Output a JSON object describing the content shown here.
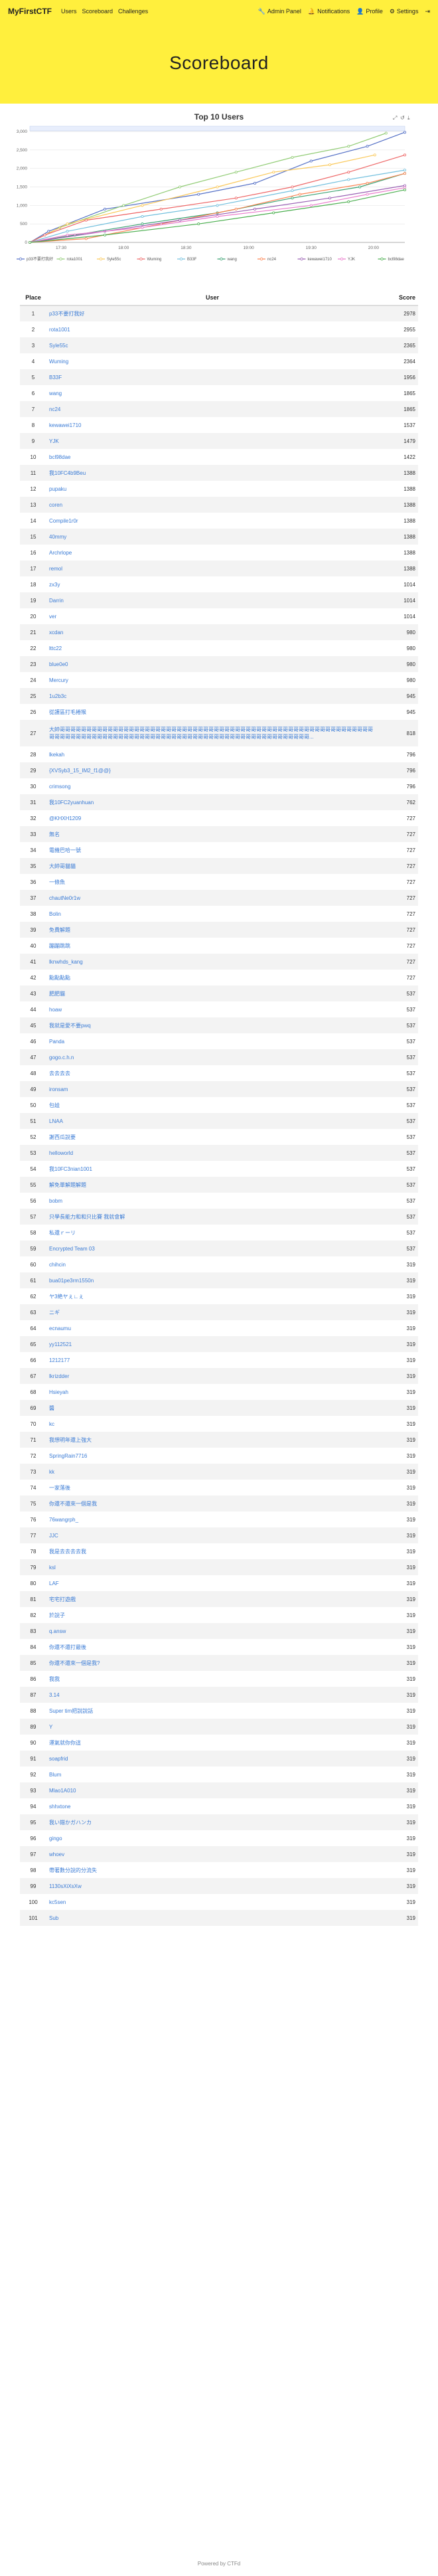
{
  "nav": {
    "brand": "MyFirstCTF",
    "left": [
      "Users",
      "Scoreboard",
      "Challenges"
    ],
    "right": [
      {
        "icon": "wrench-icon",
        "glyph": "🔧",
        "label": "Admin Panel"
      },
      {
        "icon": "bell-icon",
        "glyph": "🔔",
        "label": "Notifications"
      },
      {
        "icon": "user-circle-icon",
        "glyph": "👤",
        "label": "Profile"
      },
      {
        "icon": "gear-icon",
        "glyph": "⚙",
        "label": "Settings"
      },
      {
        "icon": "logout-icon",
        "glyph": "⇥",
        "label": ""
      }
    ]
  },
  "page_title": "Scoreboard",
  "table": {
    "headers": {
      "place": "Place",
      "user": "User",
      "score": "Score"
    }
  },
  "rows": [
    {
      "place": "1",
      "user": "p33不要打我好",
      "score": "2978"
    },
    {
      "place": "2",
      "user": "rota1001",
      "score": "2955"
    },
    {
      "place": "3",
      "user": "Syle55c",
      "score": "2365"
    },
    {
      "place": "4",
      "user": "Wuming",
      "score": "2364"
    },
    {
      "place": "5",
      "user": "B33F",
      "score": "1956"
    },
    {
      "place": "6",
      "user": "wang",
      "score": "1865"
    },
    {
      "place": "7",
      "user": "nc24",
      "score": "1865"
    },
    {
      "place": "8",
      "user": "kewawei1710",
      "score": "1537"
    },
    {
      "place": "9",
      "user": "YJK",
      "score": "1479"
    },
    {
      "place": "10",
      "user": "bcl98dae",
      "score": "1422"
    },
    {
      "place": "11",
      "user": "我10FC4b9Beu",
      "score": "1388"
    },
    {
      "place": "12",
      "user": "pupaku",
      "score": "1388"
    },
    {
      "place": "13",
      "user": "coren",
      "score": "1388"
    },
    {
      "place": "14",
      "user": "Compile1r0r",
      "score": "1388"
    },
    {
      "place": "15",
      "user": "40mmy",
      "score": "1388"
    },
    {
      "place": "16",
      "user": "Archrlope",
      "score": "1388"
    },
    {
      "place": "17",
      "user": "remol",
      "score": "1388"
    },
    {
      "place": "18",
      "user": "zx3y",
      "score": "1014"
    },
    {
      "place": "19",
      "user": "Darrin",
      "score": "1014"
    },
    {
      "place": "20",
      "user": "ver",
      "score": "1014"
    },
    {
      "place": "21",
      "user": "xcdan",
      "score": "980"
    },
    {
      "place": "22",
      "user": "lttc22",
      "score": "980"
    },
    {
      "place": "23",
      "user": "blue0e0",
      "score": "980"
    },
    {
      "place": "24",
      "user": "Mercury",
      "score": "980"
    },
    {
      "place": "25",
      "user": "1u2b3c",
      "score": "945"
    },
    {
      "place": "26",
      "user": "從護區打毛捲猴",
      "score": "945"
    },
    {
      "place": "27",
      "user": "大帥哥哥哥哥哥哥哥哥哥哥哥哥哥哥哥哥哥哥哥哥哥哥哥哥哥哥哥哥哥哥哥哥哥哥哥哥哥哥哥哥哥哥哥哥哥哥哥哥哥哥哥哥哥哥哥哥哥哥哥哥哥哥哥哥哥哥哥哥哥哥哥哥哥哥哥哥哥哥哥哥哥哥哥哥哥哥哥哥哥哥哥哥哥哥哥哥哥哥哥哥哥哥哥哥哥哥哥哥...",
      "score": "818",
      "tall": true
    },
    {
      "place": "28",
      "user": "lkekah",
      "score": "796"
    },
    {
      "place": "29",
      "user": "{XVSyb3_15_IM2_f1@@}",
      "score": "796"
    },
    {
      "place": "30",
      "user": "crimsong",
      "score": "796"
    },
    {
      "place": "31",
      "user": "我10FC2yuanhuan",
      "score": "762"
    },
    {
      "place": "32",
      "user": "@KHXH1209",
      "score": "727"
    },
    {
      "place": "33",
      "user": "無名",
      "score": "727"
    },
    {
      "place": "34",
      "user": "電機巴哈一號",
      "score": "727"
    },
    {
      "place": "35",
      "user": "大帥哥貓貓",
      "score": "727"
    },
    {
      "place": "36",
      "user": "一條魚",
      "score": "727"
    },
    {
      "place": "37",
      "user": "chautNe0r1w",
      "score": "727"
    },
    {
      "place": "38",
      "user": "Bolin",
      "score": "727"
    },
    {
      "place": "39",
      "user": "免費解題",
      "score": "727"
    },
    {
      "place": "40",
      "user": "蹦蹦跳跳",
      "score": "727"
    },
    {
      "place": "41",
      "user": "lknwhds_kang",
      "score": "727"
    },
    {
      "place": "42",
      "user": "點點點點",
      "score": "727"
    },
    {
      "place": "43",
      "user": "肥肥貓",
      "score": "537"
    },
    {
      "place": "44",
      "user": "hoaw",
      "score": "537"
    },
    {
      "place": "45",
      "user": "我就是愛不要pwq",
      "score": "537"
    },
    {
      "place": "46",
      "user": "Panda",
      "score": "537"
    },
    {
      "place": "47",
      "user": "gogo.c.h.n",
      "score": "537"
    },
    {
      "place": "48",
      "user": "去去去去",
      "score": "537"
    },
    {
      "place": "49",
      "user": "ironsam",
      "score": "537"
    },
    {
      "place": "50",
      "user": "包娃",
      "score": "537"
    },
    {
      "place": "51",
      "user": "LNAA",
      "score": "537"
    },
    {
      "place": "52",
      "user": "謝西瓜說要",
      "score": "537"
    },
    {
      "place": "53",
      "user": "helloworld",
      "score": "537"
    },
    {
      "place": "54",
      "user": "我10FC3nian1001",
      "score": "537"
    },
    {
      "place": "55",
      "user": "解免單解題解題",
      "score": "537"
    },
    {
      "place": "56",
      "user": "bobm",
      "score": "537"
    },
    {
      "place": "57",
      "user": "只學長能力和和只比賽 我就會解",
      "score": "537"
    },
    {
      "place": "58",
      "user": "私還ｒーリ",
      "score": "537"
    },
    {
      "place": "59",
      "user": "Encrypted Team 03",
      "score": "537"
    },
    {
      "place": "60",
      "user": "chihcin",
      "score": "319"
    },
    {
      "place": "61",
      "user": "bua01pe3rm1550n",
      "score": "319"
    },
    {
      "place": "62",
      "user": "ヤ3絶ヤぇ∟ぇ",
      "score": "319"
    },
    {
      "place": "63",
      "user": "ニギ",
      "score": "319"
    },
    {
      "place": "64",
      "user": "ecnaumu",
      "score": "319"
    },
    {
      "place": "65",
      "user": "yy112521",
      "score": "319"
    },
    {
      "place": "66",
      "user": "1212177",
      "score": "319"
    },
    {
      "place": "67",
      "user": "lkrizdder",
      "score": "319"
    },
    {
      "place": "68",
      "user": "Hsieyah",
      "score": "319"
    },
    {
      "place": "69",
      "user": "醬",
      "score": "319"
    },
    {
      "place": "70",
      "user": "kc",
      "score": "319"
    },
    {
      "place": "71",
      "user": "我想明年還上強大",
      "score": "319"
    },
    {
      "place": "72",
      "user": "SpringRain7716",
      "score": "319"
    },
    {
      "place": "73",
      "user": "kk",
      "score": "319"
    },
    {
      "place": "74",
      "user": "一家落後",
      "score": "319"
    },
    {
      "place": "75",
      "user": "你還不還來一個是我",
      "score": "319"
    },
    {
      "place": "76",
      "user": "76wangrph_",
      "score": "319"
    },
    {
      "place": "77",
      "user": "JJC",
      "score": "319"
    },
    {
      "place": "78",
      "user": "我是去去去去我",
      "score": "319"
    },
    {
      "place": "79",
      "user": "ksl",
      "score": "319"
    },
    {
      "place": "80",
      "user": "LAF",
      "score": "319"
    },
    {
      "place": "81",
      "user": "宅宅打遊戲",
      "score": "319"
    },
    {
      "place": "82",
      "user": "於說子",
      "score": "319"
    },
    {
      "place": "83",
      "user": "q.answ",
      "score": "319"
    },
    {
      "place": "84",
      "user": "你還不還打最後",
      "score": "319"
    },
    {
      "place": "85",
      "user": "你還不還來一個是我?",
      "score": "319"
    },
    {
      "place": "86",
      "user": "我我",
      "score": "319"
    },
    {
      "place": "87",
      "user": "3.14",
      "score": "319"
    },
    {
      "place": "88",
      "user": "Super tim把說說話",
      "score": "319"
    },
    {
      "place": "89",
      "user": "Y",
      "score": "319"
    },
    {
      "place": "90",
      "user": "運氣就你你這",
      "score": "319"
    },
    {
      "place": "91",
      "user": "soapfrid",
      "score": "319"
    },
    {
      "place": "92",
      "user": "Blum",
      "score": "319"
    },
    {
      "place": "93",
      "user": "Mlao1A010",
      "score": "319"
    },
    {
      "place": "94",
      "user": "shhxtone",
      "score": "319"
    },
    {
      "place": "95",
      "user": "我い錯かガハンカ",
      "score": "319"
    },
    {
      "place": "96",
      "user": "gingo",
      "score": "319"
    },
    {
      "place": "97",
      "user": "whoev",
      "score": "319"
    },
    {
      "place": "98",
      "user": "帶著數分說的分流失",
      "score": "319"
    },
    {
      "place": "99",
      "user": "1130sXiXsXw",
      "score": "319"
    },
    {
      "place": "100",
      "user": "kc5sen",
      "score": "319"
    },
    {
      "place": "101",
      "user": "Sub",
      "score": "319"
    }
  ],
  "footer": "Powered by CTFd",
  "chart_data": {
    "type": "line",
    "title": "Top 10 Users",
    "toolbar_icons": [
      "zoom-icon",
      "restore-icon",
      "download-icon"
    ],
    "x_ticks": [
      "17:30",
      "18:00",
      "18:30",
      "19:00",
      "19:30",
      "20:00"
    ],
    "ylim": [
      0,
      3000
    ],
    "y_ticks": [
      "0",
      "500",
      "1,000",
      "1,500",
      "2,000",
      "2,500",
      "3,000"
    ],
    "legend_position": "bottom",
    "series": [
      {
        "name": "p33不要打我好",
        "color": "#5470c6",
        "points": [
          [
            0,
            0
          ],
          [
            0.05,
            300
          ],
          [
            0.2,
            900
          ],
          [
            0.45,
            1300
          ],
          [
            0.6,
            1600
          ],
          [
            0.75,
            2200
          ],
          [
            0.9,
            2600
          ],
          [
            1,
            2978
          ]
        ]
      },
      {
        "name": "rota1001",
        "color": "#91cc75",
        "points": [
          [
            0,
            0
          ],
          [
            0.08,
            400
          ],
          [
            0.25,
            1000
          ],
          [
            0.4,
            1500
          ],
          [
            0.55,
            1900
          ],
          [
            0.7,
            2300
          ],
          [
            0.85,
            2600
          ],
          [
            0.95,
            2955
          ]
        ]
      },
      {
        "name": "Syle55c",
        "color": "#fac858",
        "points": [
          [
            0,
            0
          ],
          [
            0.1,
            500
          ],
          [
            0.3,
            1000
          ],
          [
            0.5,
            1500
          ],
          [
            0.65,
            1900
          ],
          [
            0.8,
            2100
          ],
          [
            0.92,
            2365
          ]
        ]
      },
      {
        "name": "Wuming",
        "color": "#ee6666",
        "points": [
          [
            0,
            0
          ],
          [
            0.04,
            200
          ],
          [
            0.15,
            600
          ],
          [
            0.35,
            900
          ],
          [
            0.55,
            1200
          ],
          [
            0.7,
            1500
          ],
          [
            0.85,
            1900
          ],
          [
            1,
            2364
          ]
        ]
      },
      {
        "name": "B33F",
        "color": "#73c0de",
        "points": [
          [
            0,
            0
          ],
          [
            0.1,
            300
          ],
          [
            0.3,
            700
          ],
          [
            0.5,
            1000
          ],
          [
            0.7,
            1400
          ],
          [
            0.85,
            1700
          ],
          [
            1,
            1956
          ]
        ]
      },
      {
        "name": "wang",
        "color": "#3ba272",
        "points": [
          [
            0,
            0
          ],
          [
            0.12,
            200
          ],
          [
            0.3,
            500
          ],
          [
            0.5,
            800
          ],
          [
            0.7,
            1200
          ],
          [
            0.88,
            1500
          ],
          [
            1,
            1865
          ]
        ]
      },
      {
        "name": "nc24",
        "color": "#fc8452",
        "points": [
          [
            0,
            0
          ],
          [
            0.15,
            100
          ],
          [
            0.35,
            500
          ],
          [
            0.55,
            900
          ],
          [
            0.72,
            1300
          ],
          [
            0.9,
            1600
          ],
          [
            1,
            1865
          ]
        ]
      },
      {
        "name": "kewawei1710",
        "color": "#9a60b4",
        "points": [
          [
            0,
            0
          ],
          [
            0.2,
            300
          ],
          [
            0.4,
            600
          ],
          [
            0.6,
            900
          ],
          [
            0.8,
            1200
          ],
          [
            1,
            1537
          ]
        ]
      },
      {
        "name": "YJK",
        "color": "#ea7ccc",
        "points": [
          [
            0,
            0
          ],
          [
            0.1,
            200
          ],
          [
            0.3,
            400
          ],
          [
            0.5,
            700
          ],
          [
            0.75,
            1000
          ],
          [
            0.9,
            1300
          ],
          [
            1,
            1479
          ]
        ]
      },
      {
        "name": "bcl98dae",
        "color": "#4caf50",
        "points": [
          [
            0,
            0
          ],
          [
            0.2,
            200
          ],
          [
            0.45,
            500
          ],
          [
            0.65,
            800
          ],
          [
            0.85,
            1100
          ],
          [
            1,
            1422
          ]
        ]
      }
    ]
  }
}
